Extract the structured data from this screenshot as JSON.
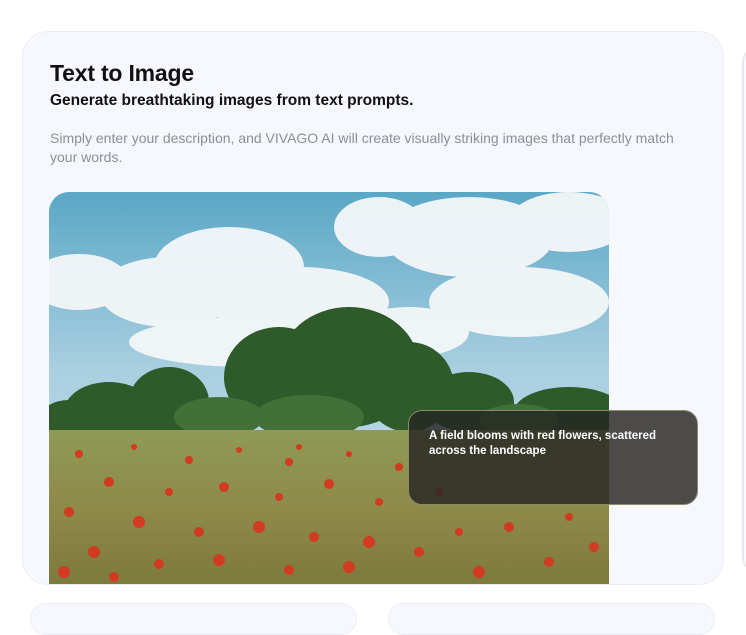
{
  "feature": {
    "title": "Text to Image",
    "subtitle": "Generate breathtaking images from text prompts.",
    "description": "Simply enter your description, and VIVAGO AI will create visually striking images that perfectly match your words.",
    "example_prompt": "A field blooms with red flowers, scattered across the landscape",
    "image_subject": "poppy-field-photo"
  }
}
